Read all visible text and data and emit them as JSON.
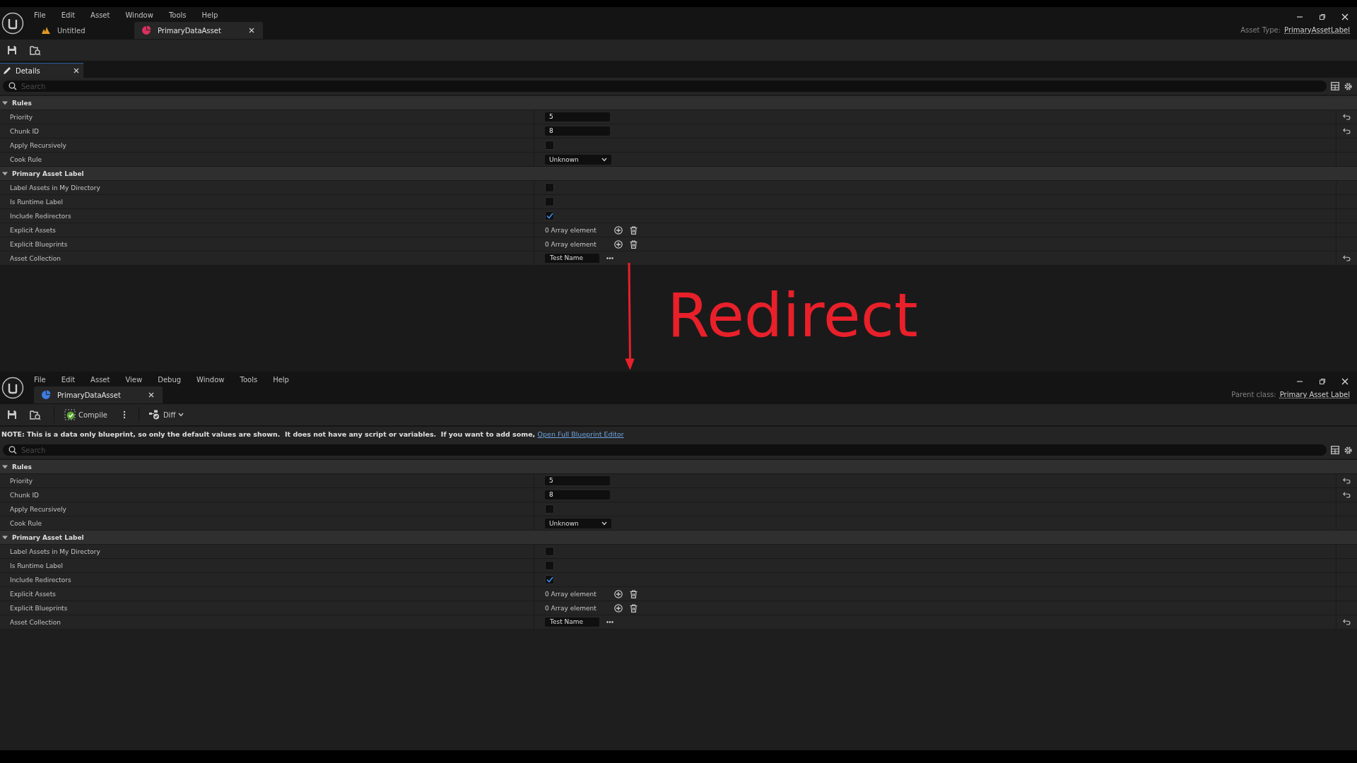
{
  "windows": [
    {
      "menu": [
        {
          "label": "File"
        },
        {
          "label": "Edit"
        },
        {
          "label": "Asset"
        },
        {
          "label": "Window"
        },
        {
          "label": "Tools"
        },
        {
          "label": "Help"
        }
      ],
      "tabs": [
        {
          "label": "Untitled",
          "kind": "level",
          "selected": false,
          "closable": false
        },
        {
          "label": "PrimaryDataAsset",
          "kind": "asset",
          "color": "#d9305f",
          "selected": true,
          "closable": true
        }
      ],
      "header": {
        "label": "Asset Type:",
        "link": "PrimaryAssetLabel"
      },
      "toolbar": [
        {
          "kind": "save"
        },
        {
          "kind": "browse"
        }
      ],
      "panel_tab": {
        "label": "Details",
        "selected": true
      },
      "search": {
        "placeholder": "Search"
      },
      "categories": [
        {
          "name": "Rules",
          "expanded": true,
          "properties": [
            {
              "label": "Priority",
              "kind": "number",
              "value": "5",
              "reset": true
            },
            {
              "label": "Chunk ID",
              "kind": "number",
              "value": "8",
              "reset": true
            },
            {
              "label": "Apply Recursively",
              "kind": "checkbox",
              "checked": false,
              "reset": false
            },
            {
              "label": "Cook Rule",
              "kind": "dropdown",
              "value": "Unknown",
              "reset": false
            }
          ]
        },
        {
          "name": "Primary Asset Label",
          "expanded": true,
          "properties": [
            {
              "label": "Label Assets in My Directory",
              "kind": "checkbox",
              "checked": false,
              "reset": false
            },
            {
              "label": "Is Runtime Label",
              "kind": "checkbox",
              "checked": false,
              "reset": false
            },
            {
              "label": "Include Redirectors",
              "kind": "checkbox",
              "checked": true,
              "reset": false
            },
            {
              "label": "Explicit Assets",
              "kind": "array",
              "value": "0 Array element",
              "reset": false
            },
            {
              "label": "Explicit Blueprints",
              "kind": "array",
              "value": "0 Array element",
              "reset": false
            },
            {
              "label": "Asset Collection",
              "kind": "text",
              "value": "Test Name",
              "reset": true
            }
          ]
        }
      ]
    },
    {
      "menu": [
        {
          "label": "File"
        },
        {
          "label": "Edit"
        },
        {
          "label": "Asset"
        },
        {
          "label": "View"
        },
        {
          "label": "Debug"
        },
        {
          "label": "Window"
        },
        {
          "label": "Tools"
        },
        {
          "label": "Help"
        }
      ],
      "tabs": [
        {
          "label": "PrimaryDataAsset",
          "kind": "asset",
          "color": "#3d7be0",
          "selected": true,
          "closable": true
        }
      ],
      "header": {
        "label": "Parent class:",
        "link": "Primary Asset Label"
      },
      "toolbar": [
        {
          "kind": "save"
        },
        {
          "kind": "browse"
        },
        {
          "kind": "compile",
          "label": "Compile"
        },
        {
          "kind": "more"
        },
        {
          "kind": "diff",
          "label": "Diff"
        }
      ],
      "note": {
        "text": "NOTE: This is a data only blueprint, so only the default values are shown.  It does not have any script or variables.  If you want to add some, ",
        "link": "Open Full Blueprint Editor"
      },
      "search": {
        "placeholder": "Search"
      },
      "categories": [
        {
          "name": "Rules",
          "expanded": true,
          "properties": [
            {
              "label": "Priority",
              "kind": "number",
              "value": "5",
              "reset": true
            },
            {
              "label": "Chunk ID",
              "kind": "number",
              "value": "8",
              "reset": true
            },
            {
              "label": "Apply Recursively",
              "kind": "checkbox",
              "checked": false,
              "reset": false
            },
            {
              "label": "Cook Rule",
              "kind": "dropdown",
              "value": "Unknown",
              "reset": false
            }
          ]
        },
        {
          "name": "Primary Asset Label",
          "expanded": true,
          "properties": [
            {
              "label": "Label Assets in My Directory",
              "kind": "checkbox",
              "checked": false,
              "reset": false
            },
            {
              "label": "Is Runtime Label",
              "kind": "checkbox",
              "checked": false,
              "reset": false
            },
            {
              "label": "Include Redirectors",
              "kind": "checkbox",
              "checked": true,
              "reset": false
            },
            {
              "label": "Explicit Assets",
              "kind": "array",
              "value": "0 Array element",
              "reset": false
            },
            {
              "label": "Explicit Blueprints",
              "kind": "array",
              "value": "0 Array element",
              "reset": false
            },
            {
              "label": "Asset Collection",
              "kind": "text",
              "value": "Test Name",
              "reset": true
            }
          ]
        }
      ]
    }
  ],
  "annotation": {
    "text": "Redirect"
  }
}
